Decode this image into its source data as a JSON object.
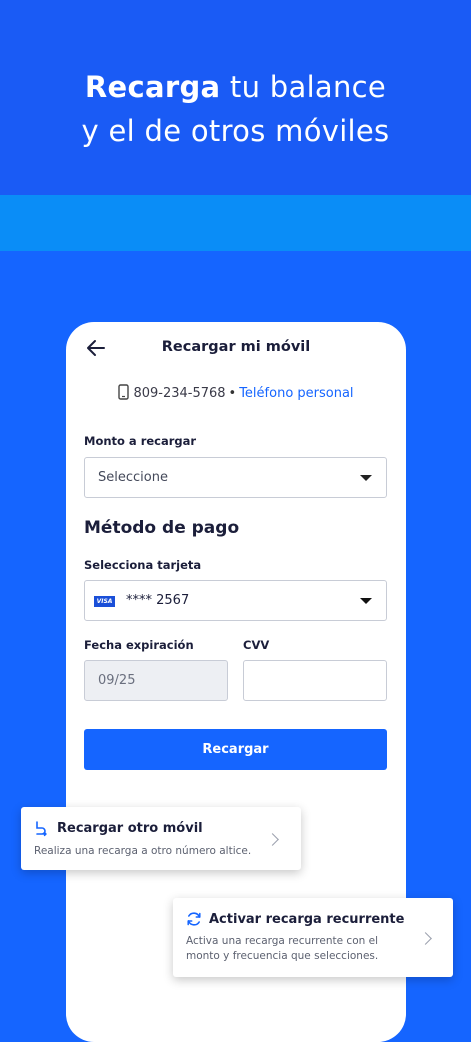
{
  "hero": {
    "line1_bold": "Recarga",
    "line1_rest": " tu balance",
    "line2": "y el de otros móviles"
  },
  "screen": {
    "title": "Recargar mi móvil",
    "phone_number": "809-234-5768",
    "separator": "•",
    "phone_tag": "Teléfono personal"
  },
  "amount": {
    "label": "Monto a recargar",
    "value": "Seleccione"
  },
  "payment": {
    "section_title": "Método de pago",
    "card_label": "Selecciona tarjeta",
    "card_brand": "VISA",
    "card_value": "**** 2567",
    "expiry_label": "Fecha expiración",
    "expiry_value": "09/25",
    "cvv_label": "CVV",
    "cvv_value": ""
  },
  "submit_label": "Recargar",
  "cards": {
    "other": {
      "title": "Recargar otro móvil",
      "subtitle": "Realiza una recarga a otro número altice."
    },
    "recurring": {
      "title": "Activar recarga recurrente",
      "subtitle_line1": "Activa una recarga recurrente con el",
      "subtitle_line2": "monto y frecuencia que selecciones."
    }
  },
  "colors": {
    "hero_bg": "#1a5bf5",
    "band": "#0a8df7",
    "primary": "#1565ff",
    "text_dark": "#1b1e3a"
  },
  "icons": [
    "back-arrow-icon",
    "mobile-phone-icon",
    "chevron-down-icon",
    "visa-card-icon",
    "send-money-icon",
    "recurring-icon",
    "chevron-right-icon"
  ]
}
